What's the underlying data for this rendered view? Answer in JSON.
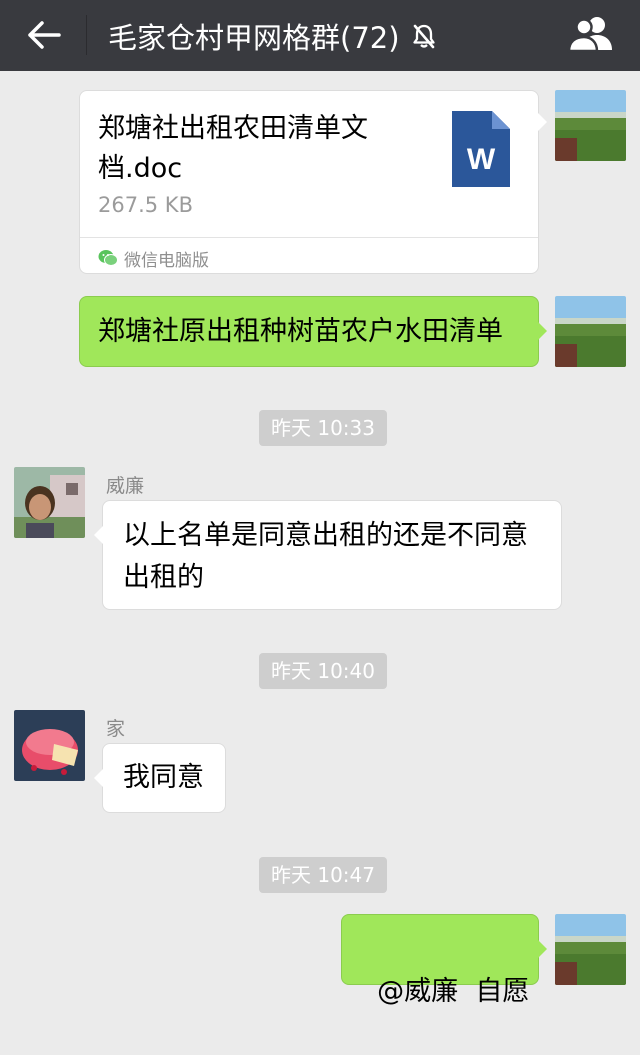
{
  "header": {
    "title": "毛家仓村甲网格群(72)",
    "icons": {
      "back": "arrow-left-icon",
      "mute": "bell-off-icon",
      "group": "group-members-icon"
    },
    "colors": {
      "background": "#393a3f",
      "text": "#ffffff"
    }
  },
  "messages": {
    "file": {
      "name": "郑塘社出租农田清单文档.doc",
      "size": "267.5 KB",
      "source": "微信电脑版",
      "file_icon": "word-doc-icon",
      "file_icon_letter": "W"
    },
    "msg1": {
      "text": "郑塘社原出租种树苗农户水田清单"
    },
    "time1": "昨天 10:33",
    "msg2": {
      "sender": "威廉",
      "text": "以上名单是同意出租的还是不同意出租的"
    },
    "time2": "昨天 10:40",
    "msg3": {
      "sender": "家",
      "text": "我同意"
    },
    "time3": "昨天 10:47",
    "msg4": {
      "text": "@威廉  自愿"
    }
  },
  "colors": {
    "chat_background": "#ebebeb",
    "self_bubble": "#a0e75a",
    "other_bubble": "#ffffff",
    "time_chip": "#cecece"
  }
}
